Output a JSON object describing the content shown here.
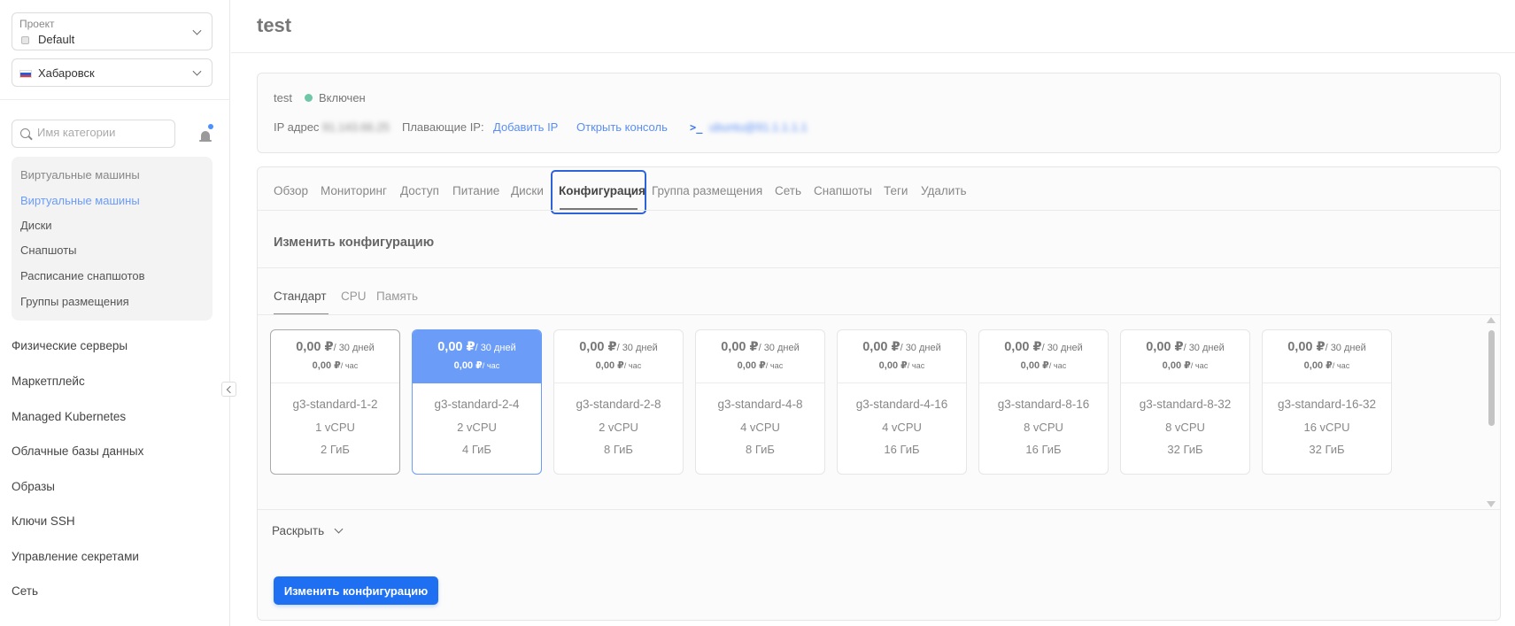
{
  "sidebar": {
    "project_label": "Проект",
    "project_value": "Default",
    "region_value": "Хабаровск",
    "search_placeholder": "Имя категории",
    "sub_items": [
      {
        "label": "Виртуальные машины"
      },
      {
        "label": "Виртуальные машины"
      },
      {
        "label": "Диски"
      },
      {
        "label": "Снапшоты"
      },
      {
        "label": "Расписание снапшотов"
      },
      {
        "label": "Группы размещения"
      }
    ],
    "nav_items": [
      {
        "label": "Физические серверы"
      },
      {
        "label": "Маркетплейс"
      },
      {
        "label": "Managed Kubernetes"
      },
      {
        "label": "Облачные базы данных"
      },
      {
        "label": "Образы"
      },
      {
        "label": "Ключи SSH"
      },
      {
        "label": "Управление секретами"
      },
      {
        "label": "Сеть"
      }
    ]
  },
  "page": {
    "title": "test"
  },
  "vm": {
    "name": "test",
    "status": "Включен",
    "ip_label": "IP адрес",
    "ip_value": "91.143.66.25",
    "floating_label": "Плавающие IP:",
    "add_ip": "Добавить IP",
    "open_console": "Открыть консоль",
    "console_icon": ">_",
    "ssh_command": "ubuntu@91.1.1.1.1"
  },
  "tabs": [
    {
      "label": "Обзор"
    },
    {
      "label": "Мониторинг"
    },
    {
      "label": "Доступ"
    },
    {
      "label": "Питание"
    },
    {
      "label": "Диски"
    },
    {
      "label": "Конфигурация"
    },
    {
      "label": "Группа размещения"
    },
    {
      "label": "Сеть"
    },
    {
      "label": "Снапшоты"
    },
    {
      "label": "Теги"
    },
    {
      "label": "Удалить"
    }
  ],
  "active_tab": "Конфигурация",
  "config": {
    "section_title": "Изменить конфигурацию",
    "subtabs": [
      {
        "label": "Стандарт"
      },
      {
        "label": "CPU"
      },
      {
        "label": "Память"
      }
    ],
    "price_month": "0,00 ₽",
    "month_unit": "/ 30 дней",
    "price_hour": "0,00 ₽",
    "hour_unit": "/ час",
    "cards": [
      {
        "name": "g3-standard-1-2",
        "cpu": "1 vCPU",
        "ram": "2 ГиБ",
        "state": "current"
      },
      {
        "name": "g3-standard-2-4",
        "cpu": "2 vCPU",
        "ram": "4 ГиБ",
        "state": "selected"
      },
      {
        "name": "g3-standard-2-8",
        "cpu": "2 vCPU",
        "ram": "8 ГиБ",
        "state": "normal"
      },
      {
        "name": "g3-standard-4-8",
        "cpu": "4 vCPU",
        "ram": "8 ГиБ",
        "state": "normal"
      },
      {
        "name": "g3-standard-4-16",
        "cpu": "4 vCPU",
        "ram": "16 ГиБ",
        "state": "normal"
      },
      {
        "name": "g3-standard-8-16",
        "cpu": "8 vCPU",
        "ram": "16 ГиБ",
        "state": "normal"
      },
      {
        "name": "g3-standard-8-32",
        "cpu": "8 vCPU",
        "ram": "32 ГиБ",
        "state": "normal"
      },
      {
        "name": "g3-standard-16-32",
        "cpu": "16 vCPU",
        "ram": "32 ГиБ",
        "state": "normal"
      },
      {
        "name": "",
        "cpu": "",
        "ram": "",
        "state": "normal"
      },
      {
        "name": "",
        "cpu": "",
        "ram": "",
        "state": "normal"
      },
      {
        "name": "",
        "cpu": "",
        "ram": "",
        "state": "normal"
      }
    ],
    "expand_label": "Раскрыть",
    "submit_label": "Изменить конфигурацию"
  },
  "colors": {
    "accent": "#1f6ff2",
    "link": "#5a8ef5",
    "selected_card": "#6b9cf7",
    "status_on": "#6fc7a7"
  }
}
